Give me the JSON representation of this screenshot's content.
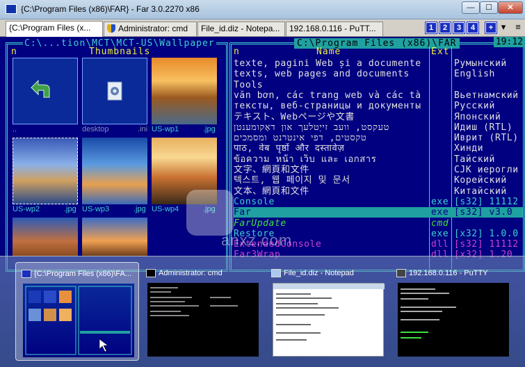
{
  "window": {
    "title": "{C:\\Program Files (x86)\\FAR} - Far 3.0.2270 x86",
    "minimize": "—",
    "maximize": "☐",
    "close": "✕"
  },
  "tabs": [
    {
      "label": "{C:\\Program Files (x..."
    },
    {
      "label": "Administrator: cmd"
    },
    {
      "label": "File_id.diz - Notepa..."
    },
    {
      "label": "192.168.0.116 - PuTT..."
    }
  ],
  "console_buttons": [
    "1",
    "2",
    "3",
    "4"
  ],
  "tool_icons": {
    "add": "+",
    "dropdown": "▾",
    "menu": "≡"
  },
  "left_panel": {
    "title": "C:\\...tion\\MCT\\MCT-US\\Wallpaper",
    "col_n": "n",
    "col_mode": "Thumbnails",
    "items": [
      {
        "name": "..",
        "ext": ""
      },
      {
        "name": "desktop",
        "ext": ".ini"
      },
      {
        "name": "US-wp1",
        "ext": ".jpg"
      },
      {
        "name": "US-wp2",
        "ext": ".jpg"
      },
      {
        "name": "US-wp3",
        "ext": ".jpg"
      },
      {
        "name": "US-wp4",
        "ext": ".jpg"
      }
    ]
  },
  "right_panel": {
    "title": "C:\\Program Files (x86)\\FAR",
    "clock": "19:12",
    "headers": {
      "n": "n",
      "name": "Name",
      "ext": "Ext"
    },
    "rows": [
      {
        "name": "texte, pagini Web și a documente",
        "ext": "",
        "desc": "Румынский",
        "color": "#e0e0e0"
      },
      {
        "name": "texts, web pages and documents",
        "ext": "",
        "desc": "English",
        "color": "#e0e0e0"
      },
      {
        "name": "Tools",
        "ext": "",
        "desc": "",
        "color": "#e0e0e0"
      },
      {
        "name": "văn bơn, các trang web và các tà",
        "ext": "",
        "desc": "Вьетнамский",
        "color": "#e0e0e0"
      },
      {
        "name": "тексты, веб-страницы и документы",
        "ext": "",
        "desc": "Русский",
        "color": "#e0e0e0"
      },
      {
        "name": "テキスト、Webページや文書",
        "ext": "",
        "desc": "Японский",
        "color": "#e0e0e0"
      },
      {
        "name": "טעקסט, וועב זייַטלעך און דאָקומענטן",
        "ext": "",
        "desc": "Идиш (RTL)",
        "color": "#e0e0e0"
      },
      {
        "name": "טקסטים, דפי אינטרנט ומסמכים",
        "ext": "",
        "desc": "Иврит (RTL)",
        "color": "#e0e0e0"
      },
      {
        "name": "पाठ, वेब पृष्ठों और दस्तावेज़",
        "ext": "",
        "desc": "Хинди",
        "color": "#e0e0e0"
      },
      {
        "name": "ข้อความ หน้า เว็บ และ เอกสาร",
        "ext": "",
        "desc": "Тайский",
        "color": "#e0e0e0"
      },
      {
        "name": "文字、網頁和文件",
        "ext": "",
        "desc": "CJK иерогли",
        "color": "#e0e0e0"
      },
      {
        "name": "텍스트, 웹 페이지 및 문서",
        "ext": "",
        "desc": "Корейский",
        "color": "#e0e0e0"
      },
      {
        "name": "文本、網頁和文件",
        "ext": "",
        "desc": "Китайский",
        "color": "#e0e0e0"
      },
      {
        "name": "Console",
        "ext": "exe",
        "desc": "[s32] 11112",
        "color": "#40d0d0"
      },
      {
        "name": "Far",
        "ext": "exe",
        "desc": "[s32] v3.0",
        "color": "#40d0d0",
        "selected": true
      },
      {
        "name": "FarUpdate",
        "ext": "cmd",
        "desc": "",
        "color": "#40e040",
        "italic": true
      },
      {
        "name": "Restore",
        "ext": "exe",
        "desc": "[x32] 1.0.0",
        "color": "#40d0d0"
      },
      {
        "name": "ExtendedConsole",
        "ext": "dll",
        "desc": "[s32] 11112",
        "color": "#d040d0"
      },
      {
        "name": "Far3Wrap",
        "ext": "dll",
        "desc": "[x32] 1.20",
        "color": "#d040d0"
      }
    ]
  },
  "previews": [
    {
      "title": "{C:\\Program Files (x86)\\FA...",
      "active": true
    },
    {
      "title": "Administrator: cmd",
      "active": false
    },
    {
      "title": "File_id.diz - Notepad",
      "active": false
    },
    {
      "title": "192.168.0.116 - PuTTY",
      "active": false
    }
  ],
  "watermark": "anxz.com"
}
